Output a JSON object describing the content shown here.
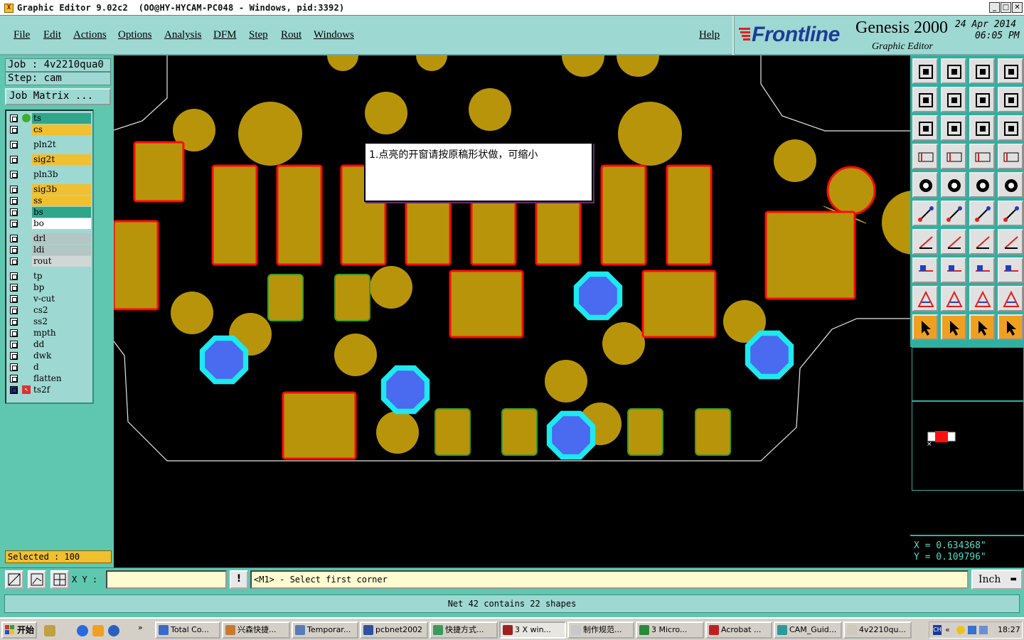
{
  "window": {
    "title": "Graphic Editor 9.02c2  (OO@HY-HYCAM-PC048 - Windows, pid:3392)",
    "icon": "app-icon",
    "controls": [
      "minimize",
      "maximize",
      "close"
    ]
  },
  "menu": {
    "items": [
      "File",
      "Edit",
      "Actions",
      "Options",
      "Analysis",
      "DFM",
      "Step",
      "Rout",
      "Windows"
    ],
    "help": "Help"
  },
  "branding": {
    "logo": "Frontline",
    "product": "Genesis 2000",
    "subtitle": "Graphic Editor",
    "date": "24 Apr 2014",
    "time": "06:05 PM"
  },
  "job": {
    "job_line": "Job : 4v2210qua0",
    "step_line": "Step: cam",
    "matrix_button": "Job Matrix ..."
  },
  "layers": [
    {
      "name": "ts",
      "bg": "#2fa58c",
      "indicator": "green-dot"
    },
    {
      "name": "cs",
      "bg": "#f0c030"
    },
    {
      "name": "pln2t",
      "bg": "#9ed8d2"
    },
    {
      "name": "sig2t",
      "bg": "#f0c030"
    },
    {
      "name": "pln3b",
      "bg": "#9ed8d2"
    },
    {
      "name": "sig3b",
      "bg": "#f0c030"
    },
    {
      "name": "ss",
      "bg": "#f0c030"
    },
    {
      "name": "bs",
      "bg": "#2fa58c"
    },
    {
      "name": "bo",
      "bg": "#ffffff"
    },
    {
      "name": "drl",
      "bg": "#b4c6c4"
    },
    {
      "name": "ldi",
      "bg": "#b4c6c4"
    },
    {
      "name": "rout",
      "bg": "#d0d8d6"
    },
    {
      "name": "tp",
      "bg": "#9ed8d2"
    },
    {
      "name": "bp",
      "bg": "#9ed8d2"
    },
    {
      "name": "v-cut",
      "bg": "#9ed8d2"
    },
    {
      "name": "cs2",
      "bg": "#9ed8d2"
    },
    {
      "name": "ss2",
      "bg": "#9ed8d2"
    },
    {
      "name": "mpth",
      "bg": "#9ed8d2"
    },
    {
      "name": "dd",
      "bg": "#9ed8d2"
    },
    {
      "name": "dwk",
      "bg": "#9ed8d2"
    },
    {
      "name": "d",
      "bg": "#9ed8d2"
    },
    {
      "name": "flatten",
      "bg": "#9ed8d2"
    },
    {
      "name": "ts2f",
      "bg": "#9ed8d2",
      "indicator": "work-layer"
    }
  ],
  "selected_status": "Selected : 100",
  "note": "1.点亮的开窗请按原稿形状做，可缩小",
  "coords": {
    "x": "X = 0.634368\"",
    "y": "Y = 0.109796\""
  },
  "command": {
    "xy_label": "X Y :",
    "xy_value": "",
    "prompt": "<M1> - Select first corner",
    "unit": "Inch"
  },
  "status_message": "Net 42 contains 22 shapes",
  "colors": {
    "pad": "#b8940a",
    "outline_red": "#ff0a0a",
    "outline_green": "#3a9a28",
    "via_blue": "#4a6af0",
    "via_cyan": "#1ee8f0"
  },
  "taskbar": {
    "start": "开始",
    "tasks": [
      {
        "label": "Total Co...",
        "color": "#3a6ac8"
      },
      {
        "label": "兴森快捷...",
        "color": "#c87830"
      },
      {
        "label": "Temporar...",
        "color": "#5a7ab8"
      },
      {
        "label": "pcbnet2002",
        "color": "#3050a0"
      },
      {
        "label": "快捷方式...",
        "color": "#3a9a5a"
      },
      {
        "label": "3 X win...",
        "color": "#a02020",
        "active": true
      },
      {
        "label": "制作规范...",
        "color": "#c8c8c8"
      },
      {
        "label": "3 Micro...",
        "color": "#2a8a3a"
      },
      {
        "label": "Acrobat ...",
        "color": "#c02020"
      },
      {
        "label": "CAM_Guid...",
        "color": "#2a9a9a"
      },
      {
        "label": "4v2210qu...",
        "color": "#d0c8b8"
      }
    ],
    "clock": "18:27",
    "ime": "CH"
  }
}
